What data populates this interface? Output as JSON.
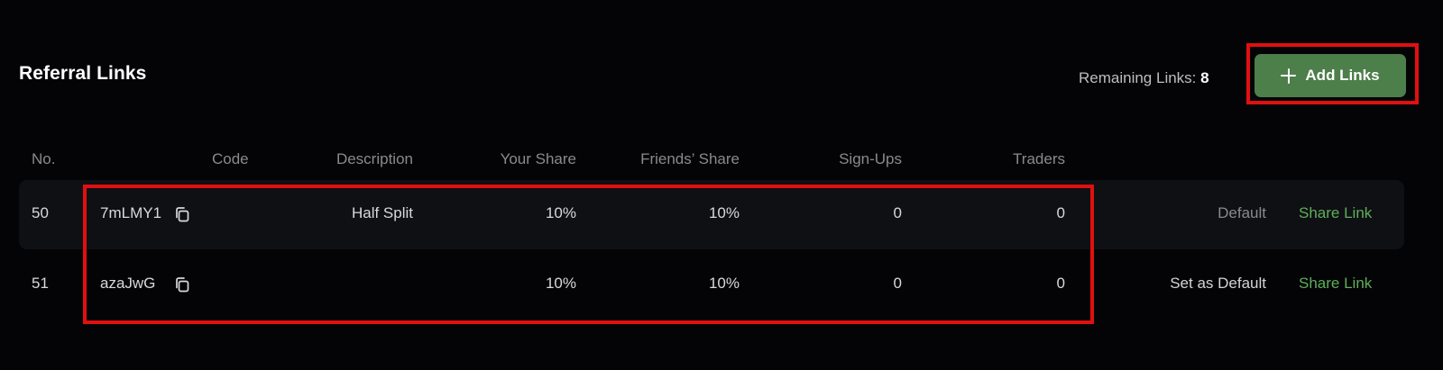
{
  "header": {
    "title": "Referral Links",
    "remaining_label": "Remaining Links:",
    "remaining_count": "8",
    "add_button_label": "Add Links"
  },
  "table": {
    "columns": {
      "no": "No.",
      "code": "Code",
      "description": "Description",
      "your_share": "Your Share",
      "friends_share": "Friends’ Share",
      "signups": "Sign-Ups",
      "traders": "Traders"
    },
    "rows": [
      {
        "no": "50",
        "code": "7mLMY1",
        "description": "Half Split",
        "your_share": "10%",
        "friends_share": "10%",
        "signups": "0",
        "traders": "0",
        "default_action": "Default",
        "share_link": "Share Link"
      },
      {
        "no": "51",
        "code": "azaJwG",
        "description": "",
        "your_share": "10%",
        "friends_share": "10%",
        "signups": "0",
        "traders": "0",
        "default_action": "Set as Default",
        "share_link": "Share Link"
      }
    ]
  },
  "colors": {
    "background": "#040407",
    "row_highlight": "#0f1014",
    "accent_green": "#4c7f49",
    "link_green": "#5fae5a",
    "annotation_red": "#e01010"
  },
  "icons": {
    "add": "plus-icon",
    "copy": "copy-icon"
  }
}
